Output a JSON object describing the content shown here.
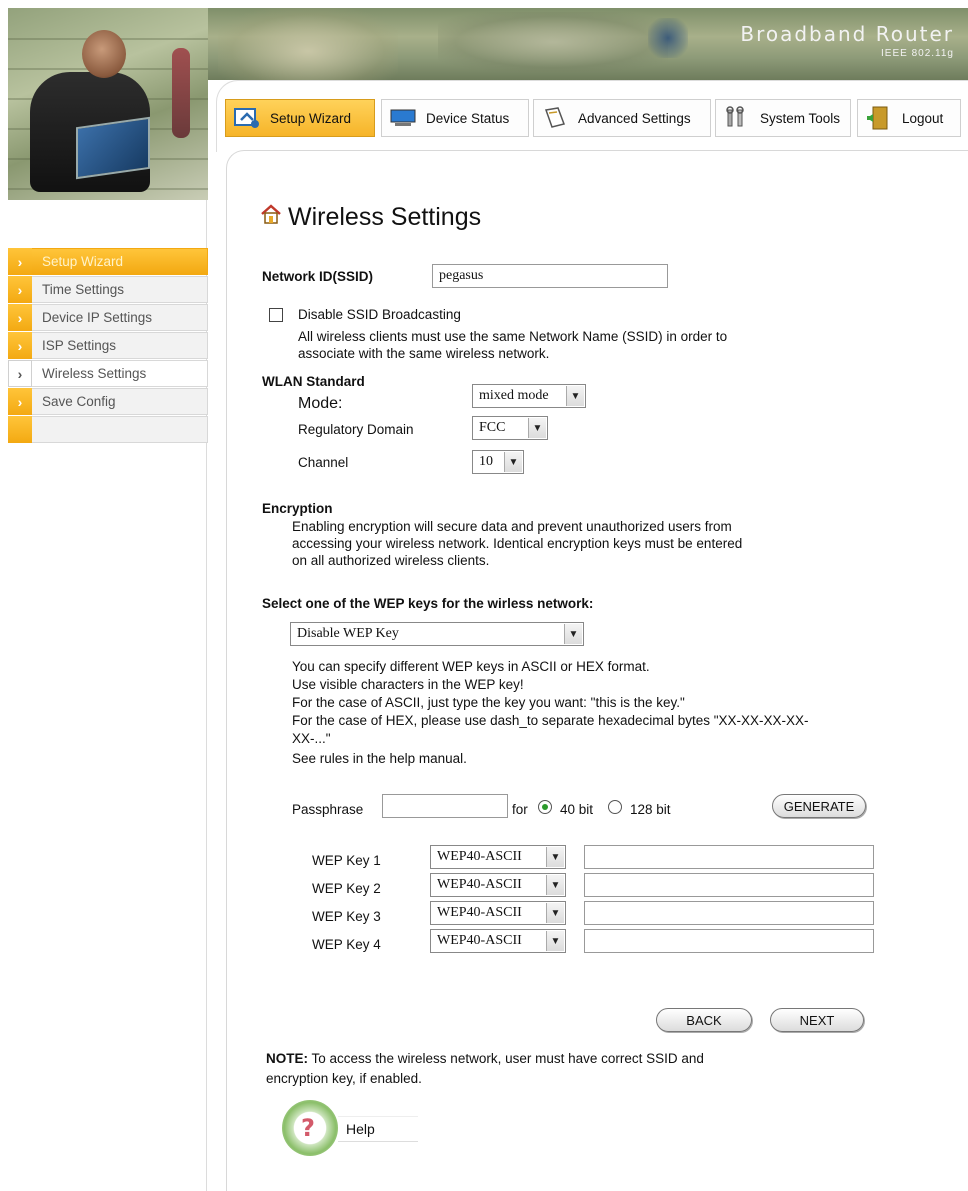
{
  "brand": {
    "title": "Broadband Router",
    "subtitle": "IEEE 802.11g"
  },
  "tabs": [
    {
      "label": "Setup Wizard",
      "icon": "wizard-icon"
    },
    {
      "label": "Device Status",
      "icon": "monitor-icon"
    },
    {
      "label": "Advanced Settings",
      "icon": "book-icon"
    },
    {
      "label": "System Tools",
      "icon": "tools-icon"
    },
    {
      "label": "Logout",
      "icon": "door-icon"
    }
  ],
  "sidebar": {
    "items": [
      {
        "label": "Setup Wizard"
      },
      {
        "label": "Time Settings"
      },
      {
        "label": "Device IP Settings"
      },
      {
        "label": "ISP Settings"
      },
      {
        "label": "Wireless Settings"
      },
      {
        "label": "Save Config"
      },
      {
        "label": ""
      }
    ]
  },
  "page": {
    "title": "Wireless Settings"
  },
  "ssid": {
    "label": "Network ID(SSID)",
    "value": "pegasus"
  },
  "broadcast": {
    "label": "Disable SSID Broadcasting",
    "desc1": "All wireless clients must use the same Network Name (SSID) in order to",
    "desc2": "associate with the same wireless network."
  },
  "wlan": {
    "heading": "WLAN Standard",
    "mode_label": "Mode:",
    "mode_value": "mixed mode",
    "domain_label": "Regulatory Domain",
    "domain_value": "FCC",
    "channel_label": "Channel",
    "channel_value": "10"
  },
  "encryption": {
    "heading": "Encryption",
    "desc1": "Enabling encryption will secure data and prevent unauthorized users from",
    "desc2": "accessing your wireless network. Identical encryption keys must be entered",
    "desc3": "on all authorized wireless clients."
  },
  "wep": {
    "heading": "Select one of the WEP keys for the wirless network:",
    "select_value": "Disable WEP Key",
    "help1": "You can specify different WEP keys in ASCII or HEX format.",
    "help2": "Use visible characters in the WEP key!",
    "help3": "For the case of ASCII, just type the key you want: \"this is the key.\"",
    "help4": "For the case of HEX, please use dash_to separate hexadecimal bytes \"XX-XX-XX-XX-",
    "help5": "XX-...\"",
    "help6": "See rules in the help manual.",
    "passphrase_label": "Passphrase",
    "passphrase_value": "",
    "for_label": "for",
    "bit40_label": "40 bit",
    "bit128_label": "128 bit",
    "generate_label": "GENERATE",
    "keys": [
      {
        "label": "WEP Key 1",
        "type": "WEP40-ASCII",
        "value": ""
      },
      {
        "label": "WEP Key 2",
        "type": "WEP40-ASCII",
        "value": ""
      },
      {
        "label": "WEP Key 3",
        "type": "WEP40-ASCII",
        "value": ""
      },
      {
        "label": "WEP Key 4",
        "type": "WEP40-ASCII",
        "value": ""
      }
    ]
  },
  "nav": {
    "back_label": "BACK",
    "next_label": "NEXT"
  },
  "note": {
    "label": "NOTE:",
    "text1": " To access the wireless network, user must have correct SSID and",
    "text2": "encryption key, if enabled."
  },
  "help": {
    "label": "Help"
  },
  "colors": {
    "accent": "#f6b429",
    "active_tab": "#ffd25a"
  }
}
